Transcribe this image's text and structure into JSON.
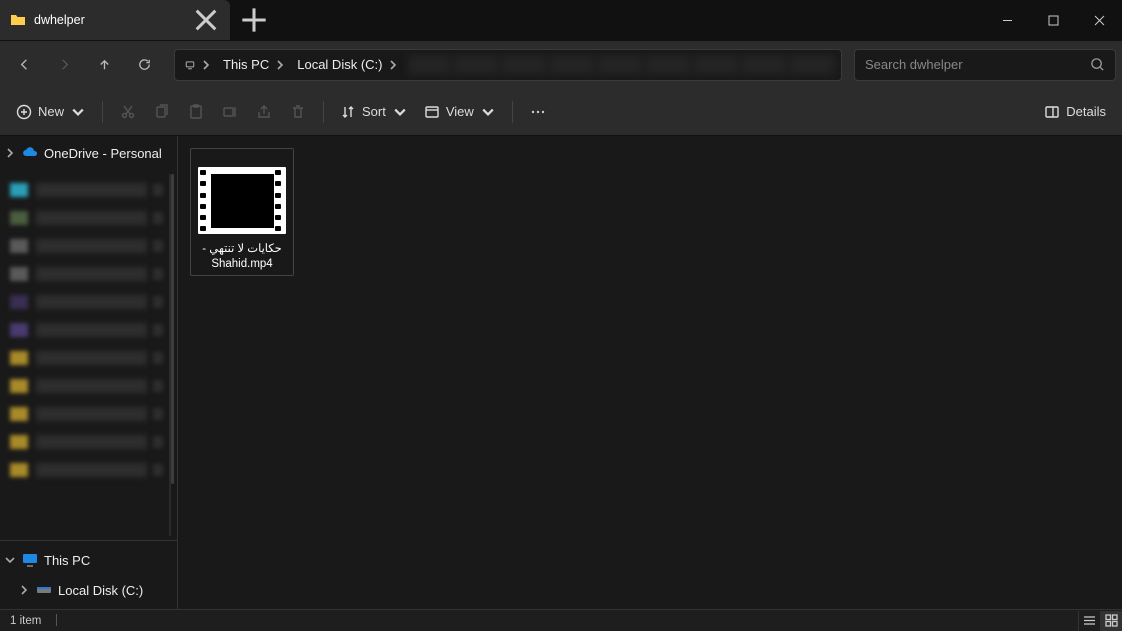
{
  "tab": {
    "title": "dwhelper"
  },
  "breadcrumb": {
    "root": "This PC",
    "drive": "Local Disk (C:)"
  },
  "search": {
    "placeholder": "Search dwhelper"
  },
  "toolbar": {
    "new": "New",
    "sort": "Sort",
    "view": "View",
    "details": "Details"
  },
  "sidebar": {
    "onedrive": "OneDrive - Personal",
    "thispc": "This PC",
    "localdisk": "Local Disk (C:)",
    "blur_colors": [
      "#2aa0b8",
      "#4a5d40",
      "#5a5a5a",
      "#5a5a5a",
      "#3a2e52",
      "#4a3a70",
      "#a88a2a",
      "#a88a2a",
      "#a88a2a",
      "#a88a2a",
      "#a88a2a"
    ]
  },
  "files": [
    {
      "name": "حكايات لا تنتهي - Shahid.mp4"
    }
  ],
  "status": {
    "count": "1 item"
  }
}
